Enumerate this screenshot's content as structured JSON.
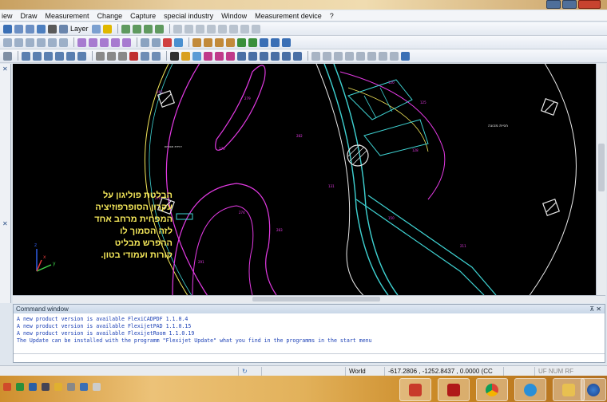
{
  "menu": [
    "iew",
    "Draw",
    "Measurement",
    "Change",
    "Capture",
    "special industry",
    "Window",
    "Measurement device",
    "?"
  ],
  "toolbar": {
    "layer_label": "Layer"
  },
  "annotation": {
    "lines": [
      "הבלטת פוליגון על",
      "עקרון הסופרפוזיציה",
      "המפחית מרחב אחד",
      "לזה הסמוך לו",
      "ההפרש מבליט",
      "קורות ועמודי בטון."
    ]
  },
  "drawing": {
    "label_right": "חניית מכונה",
    "label_left": "יחידת מגורים"
  },
  "command_window": {
    "title": "Command window",
    "pin": "⊼ ✕",
    "lines": [
      "A new product version is available FlexiCADPDF 1.1.0.4",
      "A new product version is available FlexijetPAD 1.1.0.15",
      "A new product version is available FlexijetRoom 1.1.0.19",
      "The Update can be installed with the programm \"Flexijet Update\" what you find in the  programms in the start menu"
    ]
  },
  "status": {
    "refresh_icon": "refresh-icon",
    "space": "World",
    "coords": "-617.2806 , -1252.8437 , 0.0000 (CC",
    "flags": "UF  NUM  RF"
  },
  "colors": {
    "canvas": "#000000",
    "magenta": "#e43ae4",
    "cyan": "#3fd3d3",
    "yellow": "#f5e85a",
    "white": "#e8e8e8",
    "command_text": "#1a3fb5"
  }
}
